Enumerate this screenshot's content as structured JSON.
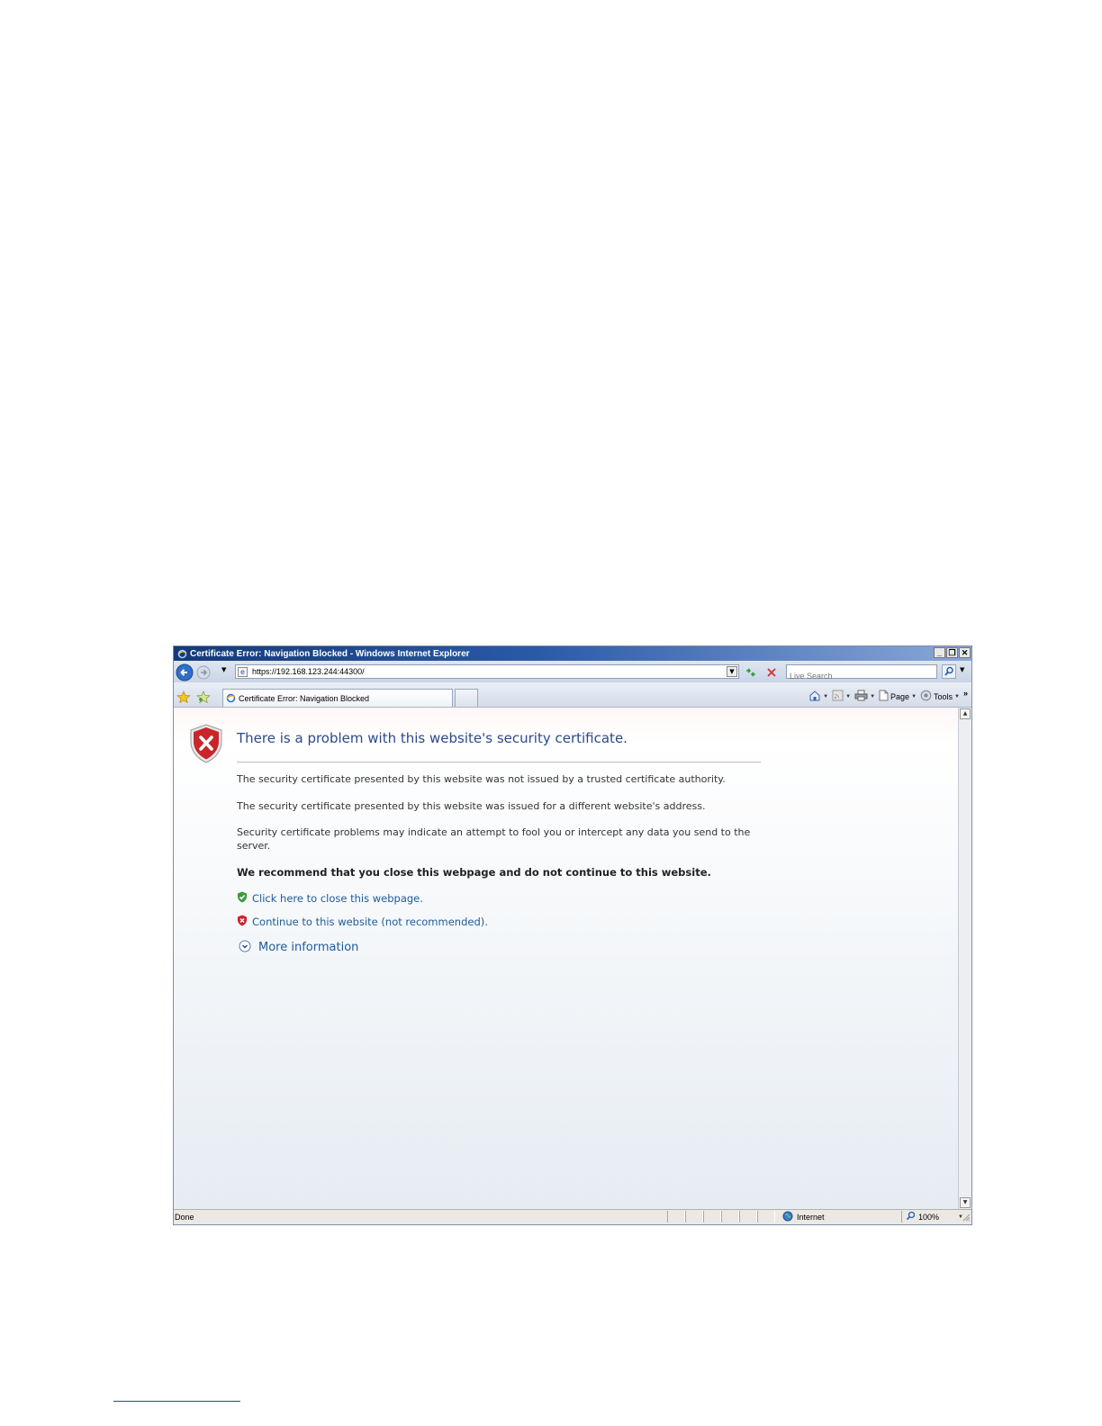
{
  "window": {
    "title": "Certificate Error: Navigation Blocked - Windows Internet Explorer",
    "controls": {
      "minimize": "_",
      "restore": "❐",
      "close": "✕"
    }
  },
  "address_bar": {
    "url": "https://192.168.123.244:44300/",
    "search_placeholder": "Live Search"
  },
  "tab": {
    "label": "Certificate Error: Navigation Blocked"
  },
  "command_bar": {
    "page_label": "Page",
    "tools_label": "Tools",
    "overflow": "»"
  },
  "content": {
    "heading": "There is a problem with this website's security certificate.",
    "line_untrusted": "The security certificate presented by this website was not issued by a trusted certificate authority.",
    "line_mismatch": "The security certificate presented by this website was issued for a different website's address.",
    "warning": "Security certificate problems may indicate an attempt to fool you or intercept any data you send to the server.",
    "recommendation": "We recommend that you close this webpage and do not continue to this website.",
    "close_link": "Click here to close this webpage.",
    "continue_link": "Continue to this website (not recommended).",
    "more_info": "More information"
  },
  "status_bar": {
    "status": "Done",
    "zone": "Internet",
    "zoom": "100%"
  },
  "icons": {
    "shield": "shield-error-icon",
    "back": "back-arrow-icon",
    "forward": "forward-arrow-icon",
    "refresh": "refresh-icon",
    "stop": "stop-icon",
    "search": "search-icon",
    "favorites": "favorites-star-icon",
    "add_favorites": "add-favorites-icon",
    "home": "home-icon",
    "feeds": "feeds-icon",
    "print": "print-icon",
    "page": "page-icon",
    "tools": "tools-gear-icon",
    "globe": "globe-icon",
    "zoom": "zoom-icon"
  },
  "colors": {
    "title_bar": "#2a59a8",
    "heading": "#2a4a8a",
    "link": "#1d5b9a",
    "shield_red": "#c8262b"
  }
}
